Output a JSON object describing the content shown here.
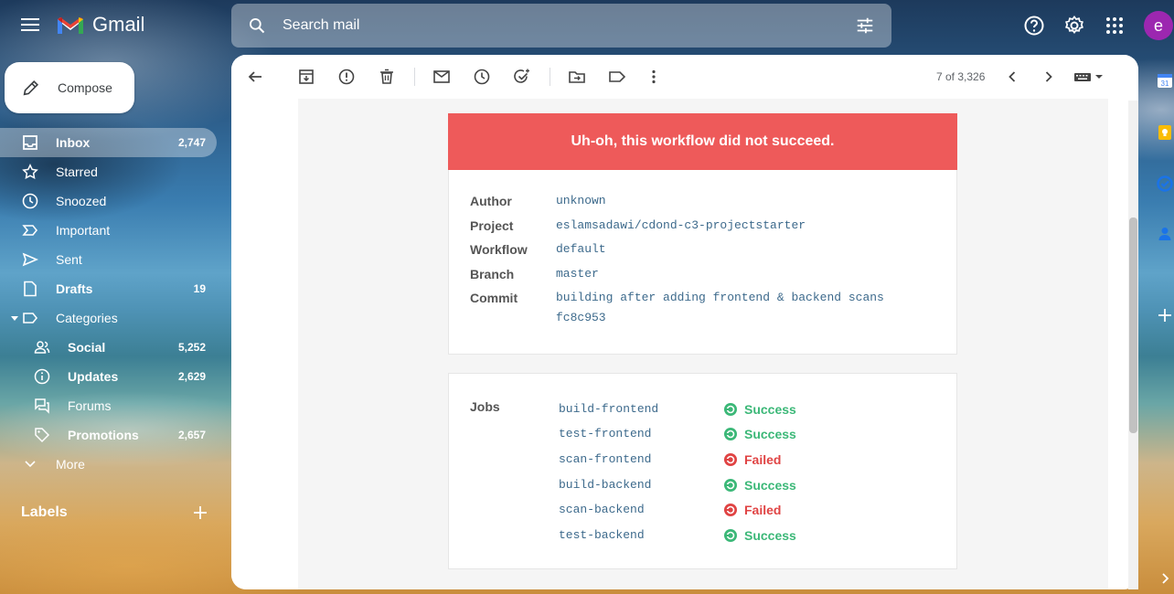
{
  "app": {
    "name": "Gmail"
  },
  "search": {
    "placeholder": "Search mail"
  },
  "avatar": {
    "initial": "e",
    "color": "#9c27b0"
  },
  "compose": {
    "label": "Compose"
  },
  "nav": {
    "inbox": {
      "label": "Inbox",
      "count": "2,747"
    },
    "starred": {
      "label": "Starred"
    },
    "snoozed": {
      "label": "Snoozed"
    },
    "important": {
      "label": "Important"
    },
    "sent": {
      "label": "Sent"
    },
    "drafts": {
      "label": "Drafts",
      "count": "19"
    },
    "categories": {
      "label": "Categories"
    },
    "social": {
      "label": "Social",
      "count": "5,252"
    },
    "updates": {
      "label": "Updates",
      "count": "2,629"
    },
    "forums": {
      "label": "Forums"
    },
    "promotions": {
      "label": "Promotions",
      "count": "2,657"
    },
    "more": {
      "label": "More"
    }
  },
  "labels": {
    "heading": "Labels"
  },
  "toolbar": {
    "pager": "7 of 3,326"
  },
  "email": {
    "banner": "Uh-oh, this workflow did not succeed.",
    "banner_color": "#ee5a5a",
    "details": [
      {
        "key": "Author",
        "value": "unknown"
      },
      {
        "key": "Project",
        "value": "eslamsadawi/cdond-c3-projectstarter"
      },
      {
        "key": "Workflow",
        "value": "default"
      },
      {
        "key": "Branch",
        "value": "master"
      },
      {
        "key": "Commit",
        "value": "building after adding frontend & backend scans",
        "value2": "fc8c953"
      }
    ],
    "jobs_label": "Jobs",
    "jobs": [
      {
        "name": "build-frontend",
        "status": "Success"
      },
      {
        "name": "test-frontend",
        "status": "Success"
      },
      {
        "name": "scan-frontend",
        "status": "Failed"
      },
      {
        "name": "build-backend",
        "status": "Success"
      },
      {
        "name": "scan-backend",
        "status": "Failed"
      },
      {
        "name": "test-backend",
        "status": "Success"
      }
    ],
    "colors": {
      "success": "#3cb878",
      "failed": "#e04444"
    }
  }
}
